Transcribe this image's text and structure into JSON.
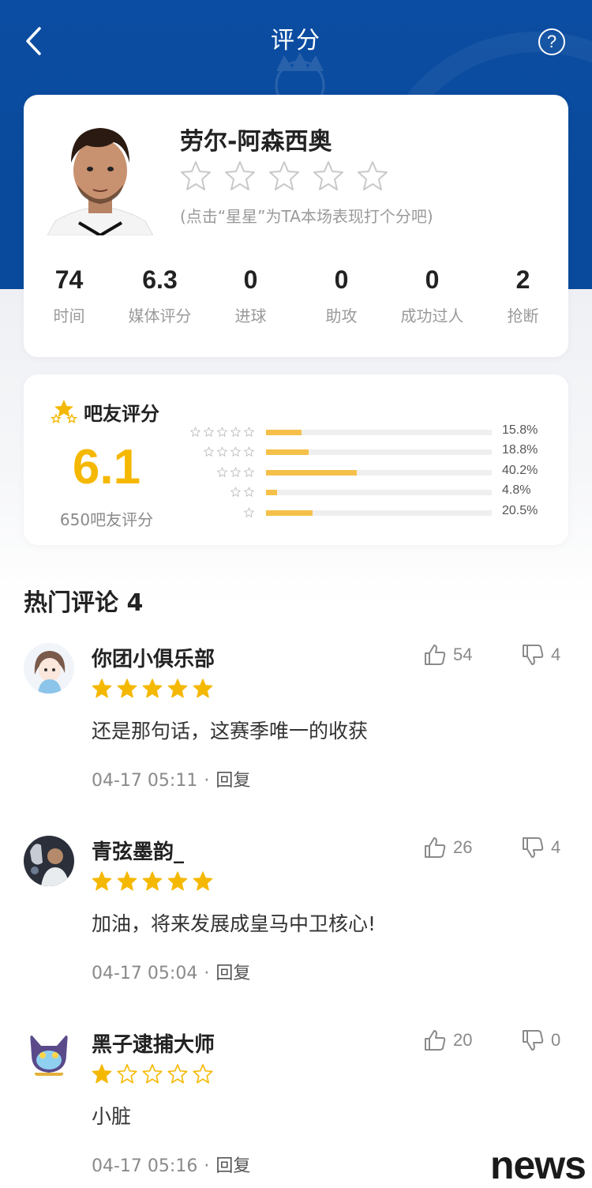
{
  "header": {
    "title": "评分"
  },
  "player": {
    "name": "劳尔-阿森西奥",
    "rate_hint": "(点击“星星”为TA本场表现打个分吧)",
    "stats": [
      {
        "value": "74",
        "label": "时间"
      },
      {
        "value": "6.3",
        "label": "媒体评分"
      },
      {
        "value": "0",
        "label": "进球"
      },
      {
        "value": "0",
        "label": "助攻"
      },
      {
        "value": "0",
        "label": "成功过人"
      },
      {
        "value": "2",
        "label": "抢断"
      }
    ]
  },
  "fan_rating": {
    "title": "吧友评分",
    "score": "6.1",
    "count_label": "650吧友评分",
    "distribution": [
      {
        "stars": 5,
        "percent": 15.8,
        "label": "15.8%"
      },
      {
        "stars": 4,
        "percent": 18.8,
        "label": "18.8%"
      },
      {
        "stars": 3,
        "percent": 40.2,
        "label": "40.2%"
      },
      {
        "stars": 2,
        "percent": 4.8,
        "label": "4.8%"
      },
      {
        "stars": 1,
        "percent": 20.5,
        "label": "20.5%"
      }
    ]
  },
  "comments_section": {
    "title": "热门评论 4"
  },
  "comments": [
    {
      "name": "你团小俱乐部",
      "rating": 5,
      "text": "还是那句话，这赛季唯一的收获",
      "time": "04-17 05:11",
      "reply": "回复",
      "likes": "54",
      "dislikes": "4"
    },
    {
      "name": "青弦墨韵_",
      "rating": 5,
      "text": "加油，将来发展成皇马中卫核心!",
      "time": "04-17 05:04",
      "reply": "回复",
      "likes": "26",
      "dislikes": "4"
    },
    {
      "name": "黑子逮捕大师",
      "rating": 1,
      "text": "小脏",
      "time": "04-17 05:16",
      "reply": "回复",
      "likes": "20",
      "dislikes": "0"
    }
  ],
  "watermark": "news",
  "colors": {
    "header_blue": "#0b4da2",
    "accent_gold": "#f5b800",
    "bar_fill": "#f5c04a"
  },
  "icons": {
    "back": "chevron-left-icon",
    "help": "question-circle-icon",
    "like": "thumbs-up-icon",
    "dislike": "thumbs-down-icon",
    "star": "star-icon"
  }
}
